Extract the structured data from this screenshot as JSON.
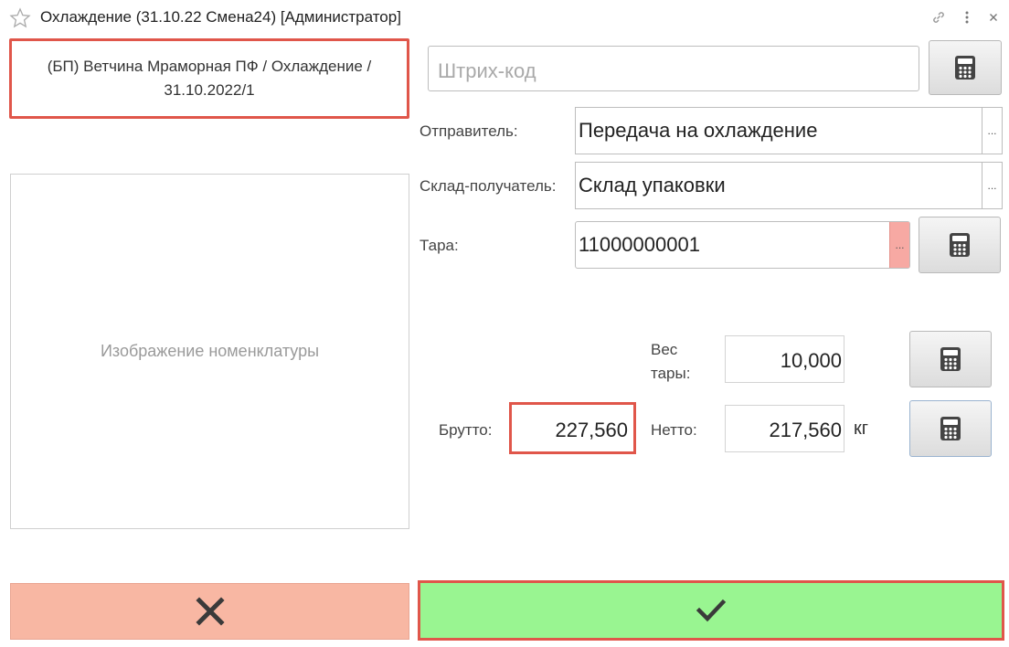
{
  "window": {
    "title": "Охлаждение (31.10.22 Смена24) [Администратор]"
  },
  "product": {
    "name": "(БП) Ветчина Мраморная ПФ / Охлаждение / 31.10.2022/1"
  },
  "image_placeholder": "Изображение номенклатуры",
  "barcode": {
    "placeholder": "Штрих-код",
    "value": ""
  },
  "form": {
    "sender_label": "Отправитель:",
    "sender_value": "Передача на охлаждение",
    "warehouse_label": "Склад-получатель:",
    "warehouse_value": "Склад упаковки",
    "tara_label": "Тара:",
    "tara_value": "11000000001",
    "tara_weight_label": "Вес тары:",
    "tara_weight_value": "10,000",
    "brutto_label": "Брутто:",
    "brutto_value": "227,560",
    "netto_label": "Нетто:",
    "netto_value": "217,560",
    "unit": "кг",
    "dots": "..."
  },
  "icons": {
    "favorite": "star-icon",
    "link": "link-icon",
    "more": "more-vertical-icon",
    "close": "close-icon",
    "calculator": "calculator-icon",
    "cancel": "cross-icon",
    "confirm": "checkmark-icon"
  },
  "colors": {
    "highlight": "#e0564a",
    "cancel_bg": "#f8b7a3",
    "ok_bg": "#99f591",
    "tara_dots_bg": "#f7a9a3"
  }
}
